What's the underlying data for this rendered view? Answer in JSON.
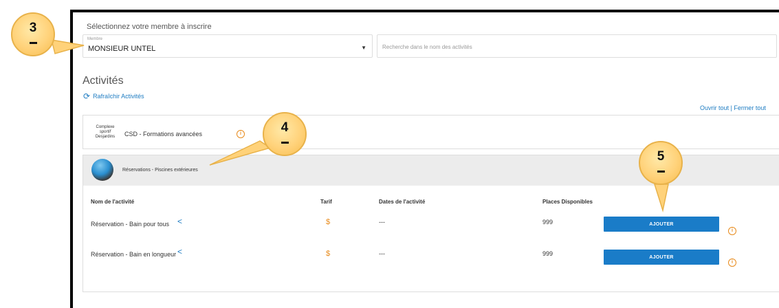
{
  "form": {
    "hint": "Sélectionnez votre membre à inscrire",
    "member_label": "Membre",
    "member_value": "MONSIEUR UNTEL",
    "search_placeholder": "Recherche dans le nom des activités"
  },
  "activities": {
    "title": "Activités",
    "refresh_label": "Rafraîchir Activités",
    "open_all": "Ouvrir tout",
    "separator": "|",
    "close_all": "Fermer tout",
    "group1": {
      "logo_line1": "Complexe",
      "logo_line2": "sportif",
      "logo_line3": "Desjardins",
      "title": "CSD - Formations avancées"
    },
    "group2": {
      "title": "Réservations - Piscines extérieures",
      "columns": {
        "name": "Nom de l'activité",
        "tarif": "Tarif",
        "dates": "Dates de l'activité",
        "places": "Places Disponibles"
      },
      "rows": [
        {
          "name": "Réservation - Bain pour tous",
          "tarif": "$",
          "dates": "---",
          "places": "999",
          "button": "AJOUTER"
        },
        {
          "name": "Réservation - Bain en longueur",
          "tarif": "$",
          "dates": "---",
          "places": "999",
          "button": "AJOUTER"
        }
      ]
    }
  },
  "callouts": [
    {
      "number": "3"
    },
    {
      "number": "4"
    },
    {
      "number": "5"
    }
  ],
  "colors": {
    "accent": "#1a7cc8",
    "tarif": "#e88a1a",
    "callout": "#ffd27a",
    "link": "#1e7cc2"
  },
  "icons": {
    "share": "share-icon",
    "info": "info-icon",
    "refresh": "refresh-icon",
    "caret": "caret-down-icon"
  }
}
